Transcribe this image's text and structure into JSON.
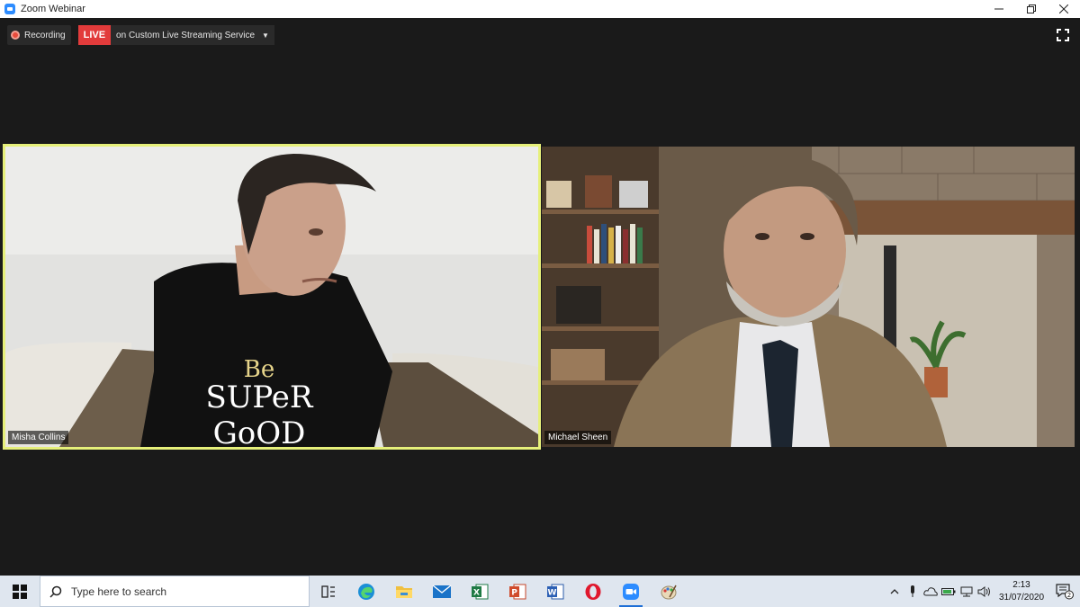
{
  "window": {
    "title": "Zoom Webinar"
  },
  "toolbar": {
    "recording_label": "Recording",
    "live_label": "LIVE",
    "stream_label": "on Custom Live Streaming Service"
  },
  "participants": [
    {
      "name": "Misha Collins",
      "active_speaker": true
    },
    {
      "name": "Michael Sheen",
      "active_speaker": false
    }
  ],
  "taskbar": {
    "search_placeholder": "Type here to search",
    "apps": [
      "task-view",
      "edge",
      "file-explorer",
      "mail",
      "excel",
      "powerpoint",
      "word",
      "opera",
      "zoom",
      "paint"
    ],
    "active_app": "zoom",
    "clock_time": "2:13",
    "clock_date": "31/07/2020",
    "notification_count": "2"
  },
  "colors": {
    "active_border": "#e6f07a",
    "live_red": "#e23b3b",
    "zoom_blue": "#2d8cff"
  }
}
